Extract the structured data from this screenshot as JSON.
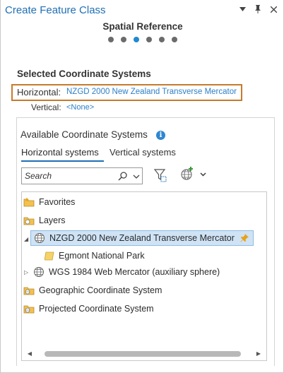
{
  "pane": {
    "title": "Create Feature Class",
    "step_title": "Spatial Reference",
    "steps": 6,
    "active_step": 3
  },
  "selected": {
    "heading": "Selected Coordinate Systems",
    "horizontal_label": "Horizontal:",
    "horizontal_value": "NZGD 2000 New Zealand Transverse Mercator",
    "vertical_label": "Vertical:",
    "vertical_value": "<None>"
  },
  "available": {
    "heading": "Available Coordinate Systems",
    "tabs": [
      {
        "label": "Horizontal systems",
        "active": true
      },
      {
        "label": "Vertical systems",
        "active": false
      }
    ],
    "search": {
      "placeholder": "Search",
      "value": ""
    },
    "tree": [
      {
        "label": "Favorites",
        "icon": "favorites-folder-icon"
      },
      {
        "label": "Layers",
        "icon": "layers-folder-icon"
      },
      {
        "label": "NZGD 2000 New Zealand Transverse Mercator",
        "icon": "globe-icon",
        "selected": true,
        "expanded": true
      },
      {
        "label": "Egmont National Park",
        "icon": "polygon-layer-icon"
      },
      {
        "label": "WGS 1984 Web Mercator (auxiliary sphere)",
        "icon": "globe-icon",
        "expanded": false
      },
      {
        "label": "Geographic Coordinate System",
        "icon": "folder-globe-icon"
      },
      {
        "label": "Projected Coordinate System",
        "icon": "folder-globe-icon"
      }
    ]
  },
  "colors": {
    "accent": "#1f6fb4",
    "link": "#2c7fc8",
    "highlight_border": "#c67a2c",
    "selection_bg": "#cfe3f5"
  }
}
